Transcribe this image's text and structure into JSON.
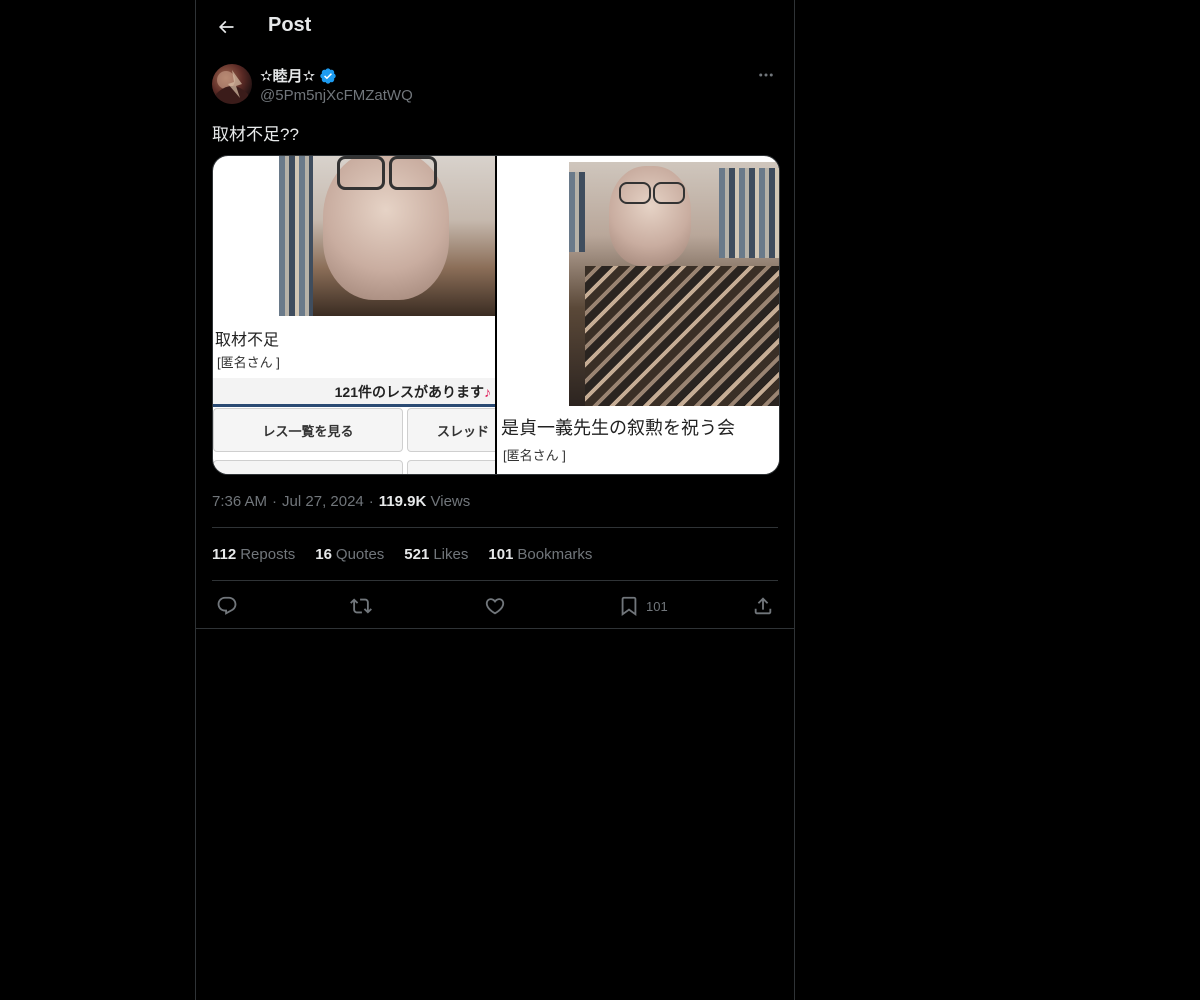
{
  "header": {
    "title": "Post"
  },
  "author": {
    "display_name": "✫睦月✫",
    "handle": "@5Pm5njXcFMZatWQ",
    "verified": true,
    "verified_color": "#1d9bf0"
  },
  "post": {
    "text": "取材不足??",
    "media": [
      {
        "caption": "取材不足",
        "subcaption": "[匿名さん ]",
        "count_text": "121件のレスがあります",
        "count_note": "♪",
        "buttons": [
          "レス一覧を見る",
          "スレッド"
        ]
      },
      {
        "caption": "是貞一義先生の叙勲を祝う会",
        "subcaption": "[匿名さん ]"
      }
    ]
  },
  "meta": {
    "time": "7:36 AM",
    "date": "Jul 27, 2024",
    "views_count": "119.9K",
    "views_label": "Views"
  },
  "stats": {
    "reposts_count": "112",
    "reposts_label": "Reposts",
    "quotes_count": "16",
    "quotes_label": "Quotes",
    "likes_count": "521",
    "likes_label": "Likes",
    "bookmarks_count": "101",
    "bookmarks_label": "Bookmarks"
  },
  "actions": {
    "reply_icon": "reply-icon",
    "repost_icon": "repost-icon",
    "like_icon": "heart-icon",
    "bookmark_icon": "bookmark-icon",
    "bookmark_count": "101",
    "share_icon": "share-icon"
  },
  "colors": {
    "background": "#000000",
    "text": "#e7e9ea",
    "muted": "#71767b",
    "border": "#2f3336",
    "accent": "#1d9bf0"
  }
}
